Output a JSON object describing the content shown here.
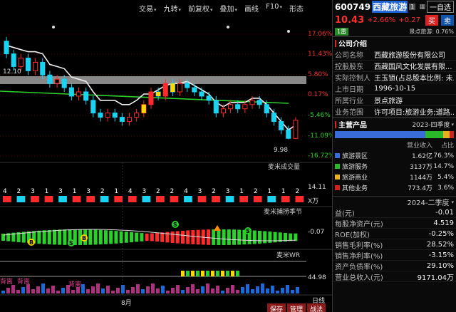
{
  "toolbar": {
    "items": [
      "交易",
      "九转",
      "前复权",
      "叠加",
      "画线",
      "F10",
      "形态"
    ]
  },
  "chart_data": [
    {
      "type": "candlestick",
      "title": "",
      "y_axis": [
        "17.06%",
        "11.43%",
        "5.80%",
        "0.17%",
        "-5.46%",
        "-11.09%",
        "-16.72%"
      ],
      "annotations": [
        "12.10",
        "9.98"
      ],
      "candles": [
        [
          12.3,
          12.0,
          12.4,
          11.9
        ],
        [
          12.0,
          11.7,
          12.1,
          11.6
        ],
        [
          11.7,
          11.9,
          12.0,
          11.6
        ],
        [
          11.9,
          11.6,
          12.0,
          11.5
        ],
        [
          11.6,
          11.8,
          11.9,
          11.5
        ],
        [
          11.8,
          11.5,
          11.9,
          11.4
        ],
        [
          11.5,
          11.3,
          11.6,
          11.2
        ],
        [
          11.3,
          11.4,
          11.5,
          11.2
        ],
        [
          11.4,
          11.2,
          11.5,
          11.1
        ],
        [
          11.2,
          11.0,
          11.3,
          10.9
        ],
        [
          11.0,
          11.1,
          11.2,
          10.9
        ],
        [
          11.1,
          10.9,
          11.2,
          10.8
        ],
        [
          10.9,
          10.6,
          11.0,
          10.5
        ],
        [
          10.6,
          10.5,
          10.7,
          10.4
        ],
        [
          10.5,
          10.6,
          10.7,
          10.4
        ],
        [
          10.6,
          10.5,
          10.7,
          10.4
        ],
        [
          10.5,
          10.4,
          10.6,
          10.3
        ],
        [
          10.4,
          10.5,
          10.6,
          10.3
        ],
        [
          10.5,
          10.6,
          10.7,
          10.4
        ],
        [
          10.6,
          10.8,
          10.9,
          10.5
        ],
        [
          10.8,
          11.1,
          11.2,
          10.7
        ],
        [
          11.1,
          11.0,
          11.2,
          10.9
        ],
        [
          11.0,
          11.3,
          11.4,
          10.9
        ],
        [
          11.3,
          11.1,
          11.4,
          11.0
        ],
        [
          11.1,
          11.3,
          11.4,
          11.0
        ],
        [
          11.3,
          11.2,
          11.4,
          11.1
        ],
        [
          11.2,
          11.1,
          11.3,
          11.0
        ],
        [
          11.1,
          11.0,
          11.2,
          10.9
        ],
        [
          11.0,
          10.9,
          11.1,
          10.8
        ],
        [
          10.9,
          10.6,
          11.0,
          10.5
        ],
        [
          10.6,
          10.7,
          10.8,
          10.5
        ],
        [
          10.7,
          10.8,
          10.9,
          10.6
        ],
        [
          10.8,
          10.7,
          10.9,
          10.6
        ],
        [
          10.7,
          10.8,
          10.9,
          10.6
        ],
        [
          10.8,
          10.9,
          11.0,
          10.7
        ],
        [
          10.9,
          10.8,
          11.0,
          10.7
        ],
        [
          10.8,
          10.6,
          10.9,
          10.5
        ],
        [
          10.6,
          10.4,
          10.7,
          10.3
        ],
        [
          10.4,
          10.2,
          10.5,
          10.1
        ],
        [
          10.2,
          10.0,
          10.3,
          9.98
        ],
        [
          10.0,
          10.43,
          10.5,
          9.98
        ]
      ]
    },
    {
      "type": "bar",
      "title": "麦米成交量",
      "y_axis": [
        "14.11",
        "X万"
      ],
      "counts": [
        "4",
        "2",
        "3",
        "1",
        "3",
        "1",
        "3",
        "2",
        "1",
        "4",
        "3",
        "2",
        "2",
        "4",
        "3",
        "2",
        "3",
        "1",
        "2",
        "1",
        "1",
        "2"
      ]
    },
    {
      "type": "bar",
      "title": "麦米捕捞季节",
      "y_axis": [
        "-0.07"
      ],
      "markers": [
        "B",
        "B",
        "S",
        "S",
        "S"
      ]
    },
    {
      "type": "line",
      "title": "麦米WR",
      "y_axis": [
        "44.98"
      ],
      "annotations": [
        "背离",
        "背离",
        "背离"
      ]
    }
  ],
  "xaxis": {
    "month_label": "8月"
  },
  "bottom": {
    "day": "日线",
    "save": "保存",
    "manage": "管理",
    "battle": "战法"
  },
  "sidebar": {
    "code": "600749",
    "name": "西藏旅游",
    "badge": "1",
    "watch": "一自选",
    "price": "10.43",
    "change": "+2.66%",
    "change_abs": "+0.27",
    "buy": "买",
    "sell": "卖",
    "tag_green": "1雷",
    "tag_text": "景点旅游: 0.76%",
    "company_title": "公司介绍",
    "company": [
      [
        "公司名称",
        "西藏旅游股份有限公司"
      ],
      [
        "控股股东",
        "西藏国风文化发展有限..."
      ],
      [
        "实际控制人",
        "王玉锁(占总股本比例: 未..."
      ],
      [
        "上市日期",
        "1996-10-15"
      ],
      [
        "所属行业",
        "景点旅游"
      ],
      [
        "业务范围",
        "许可项目:旅游业务;道路..."
      ]
    ],
    "product_title": "主营产品",
    "product_period": "2023-四季度",
    "product_cols": [
      "营业收入",
      "占比"
    ],
    "products": [
      [
        "旅游景区",
        "1.62亿",
        "76.3%",
        "#3a6cd9"
      ],
      [
        "旅游服务",
        "3137万",
        "14.7%",
        "#2ab82a"
      ],
      [
        "旅游商业",
        "1144万",
        "5.4%",
        "#e8b020"
      ],
      [
        "其他业务",
        "773.4万",
        "3.6%",
        "#d02020"
      ]
    ],
    "fin_period": "2024-二季度",
    "fin": [
      [
        "益(元)",
        "-0.01"
      ],
      [
        "每股净资产(元)",
        "4.519"
      ],
      [
        "ROE(加权)",
        "-0.25%"
      ],
      [
        "销售毛利率(%)",
        "28.52%"
      ],
      [
        "销售净利率(%)",
        "-3.15%"
      ],
      [
        "资产负债率(%)",
        "29.10%"
      ],
      [
        "营业总收入(元)",
        "9171.04万"
      ]
    ]
  }
}
